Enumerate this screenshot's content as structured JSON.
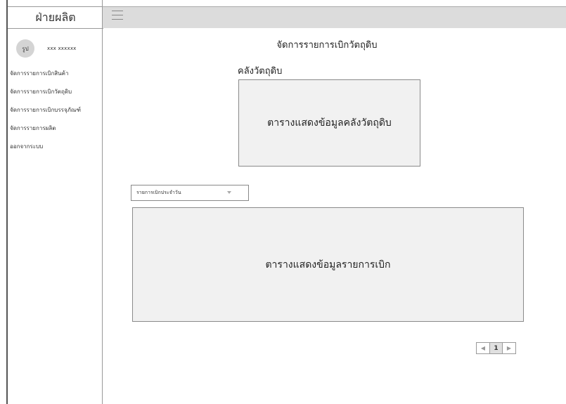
{
  "sidebar": {
    "header": "ฝ่ายผลิต",
    "avatar_label": "รูป",
    "user_name": "xxx xxxxxx",
    "items": [
      {
        "label": "จัดการรายการเบิกสินค้า"
      },
      {
        "label": "จัดการรายการเบิกวัตถุดิบ"
      },
      {
        "label": "จัดการรายการเบิกบรรจุภัณฑ์"
      },
      {
        "label": "จัดการรายการผลิต"
      },
      {
        "label": "ออกจากระบบ"
      }
    ]
  },
  "topbar": {
    "menu_icon": "hamburger-icon"
  },
  "main": {
    "page_title": "จัดการรายการเบิกวัตถุดิบ",
    "warehouse_title": "คลังวัตถุดิบ",
    "warehouse_table_placeholder": "ตารางแสดงข้อมูลคลังวัตถุดิบ",
    "filter_select_value": "รายการเบิกประจำวัน",
    "withdraw_table_placeholder": "ตารางแสดงข้อมูลรายการเบิก",
    "pagination": {
      "prev": "◀",
      "current_page": "1",
      "next": "▶"
    }
  },
  "colors": {
    "topbar_bg": "#dcdcdc",
    "box_bg": "#f1f1f1",
    "avatar_bg": "#d4d4d4"
  }
}
